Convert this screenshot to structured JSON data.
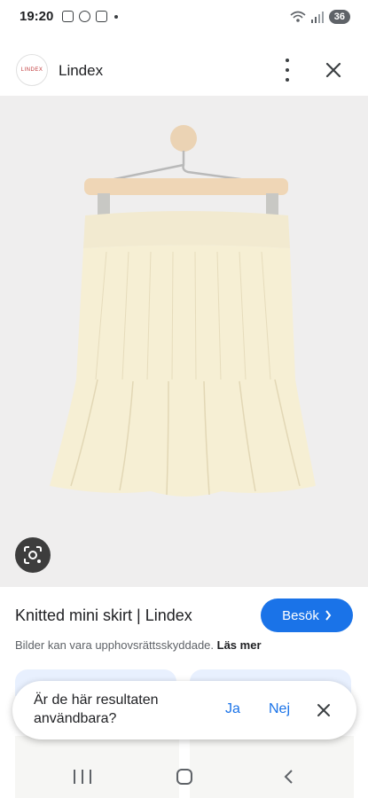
{
  "status_bar": {
    "time": "19:20",
    "battery": "36"
  },
  "header": {
    "logo_text": "LINDEX",
    "site_name": "Lindex"
  },
  "product": {
    "title": "Knitted mini skirt | Lindex",
    "visit_label": "Besök",
    "copyright_text": "Bilder kan vara upphovsrättsskyddade.",
    "learn_more": "Läs mer"
  },
  "feedback": {
    "question": "Är de här resultaten användbara?",
    "yes": "Ja",
    "no": "Nej"
  },
  "icons": {
    "more": "more-vert-icon",
    "close": "close-icon",
    "lens": "google-lens-icon",
    "visit_arrow": "chevron-right-icon",
    "nav_recents": "recents-icon",
    "nav_home": "home-icon",
    "nav_back": "back-icon"
  },
  "colors": {
    "accent": "#1a73e8",
    "image_bg": "#efeeee",
    "skirt": "#f6efd2",
    "hanger": "#efd7b8"
  }
}
